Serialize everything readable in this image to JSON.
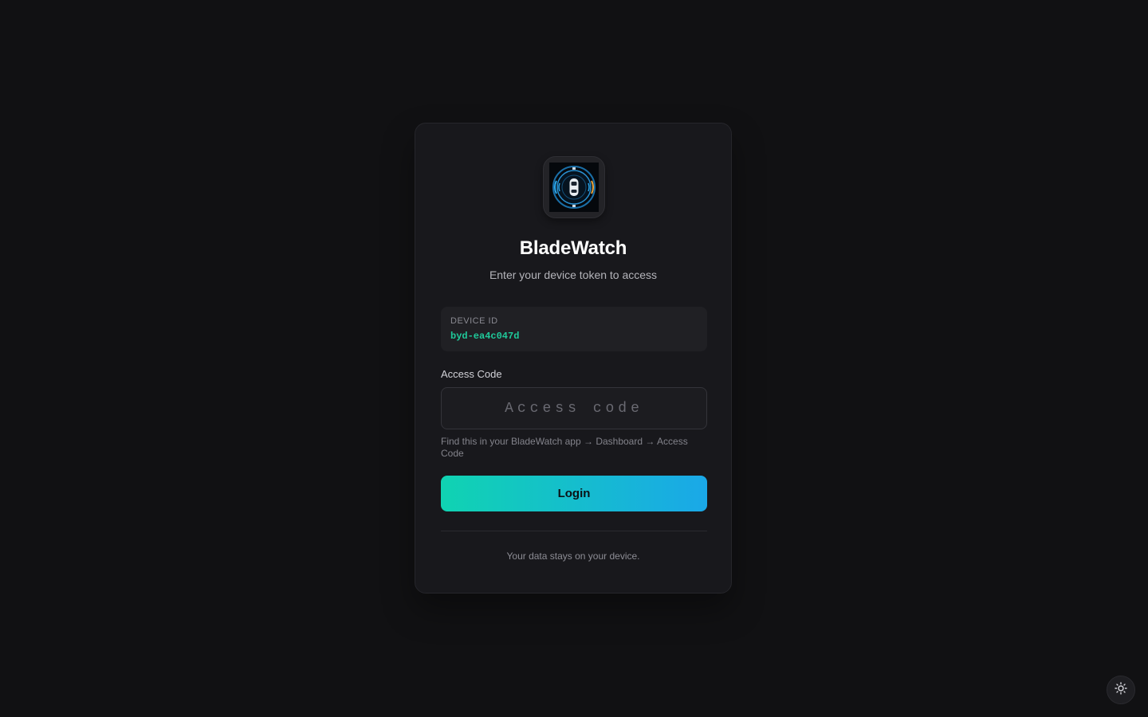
{
  "app": {
    "title": "BladeWatch",
    "subtitle": "Enter your device token to access",
    "logo_icon": "car-radar-icon"
  },
  "device": {
    "label": "DEVICE ID",
    "value": "byd-ea4c047d"
  },
  "access_code": {
    "label": "Access Code",
    "placeholder": "Access code",
    "value": "",
    "hint": "Find this in your BladeWatch app → Dashboard → Access Code"
  },
  "login": {
    "label": "Login"
  },
  "footer": {
    "note": "Your data stays on your device."
  },
  "theme_toggle": {
    "icon": "sun-icon"
  },
  "colors": {
    "background": "#111113",
    "card": "#18181c",
    "accent_start": "#10d3b2",
    "accent_end": "#1aa8e8",
    "device_id_text": "#1fc99a"
  }
}
